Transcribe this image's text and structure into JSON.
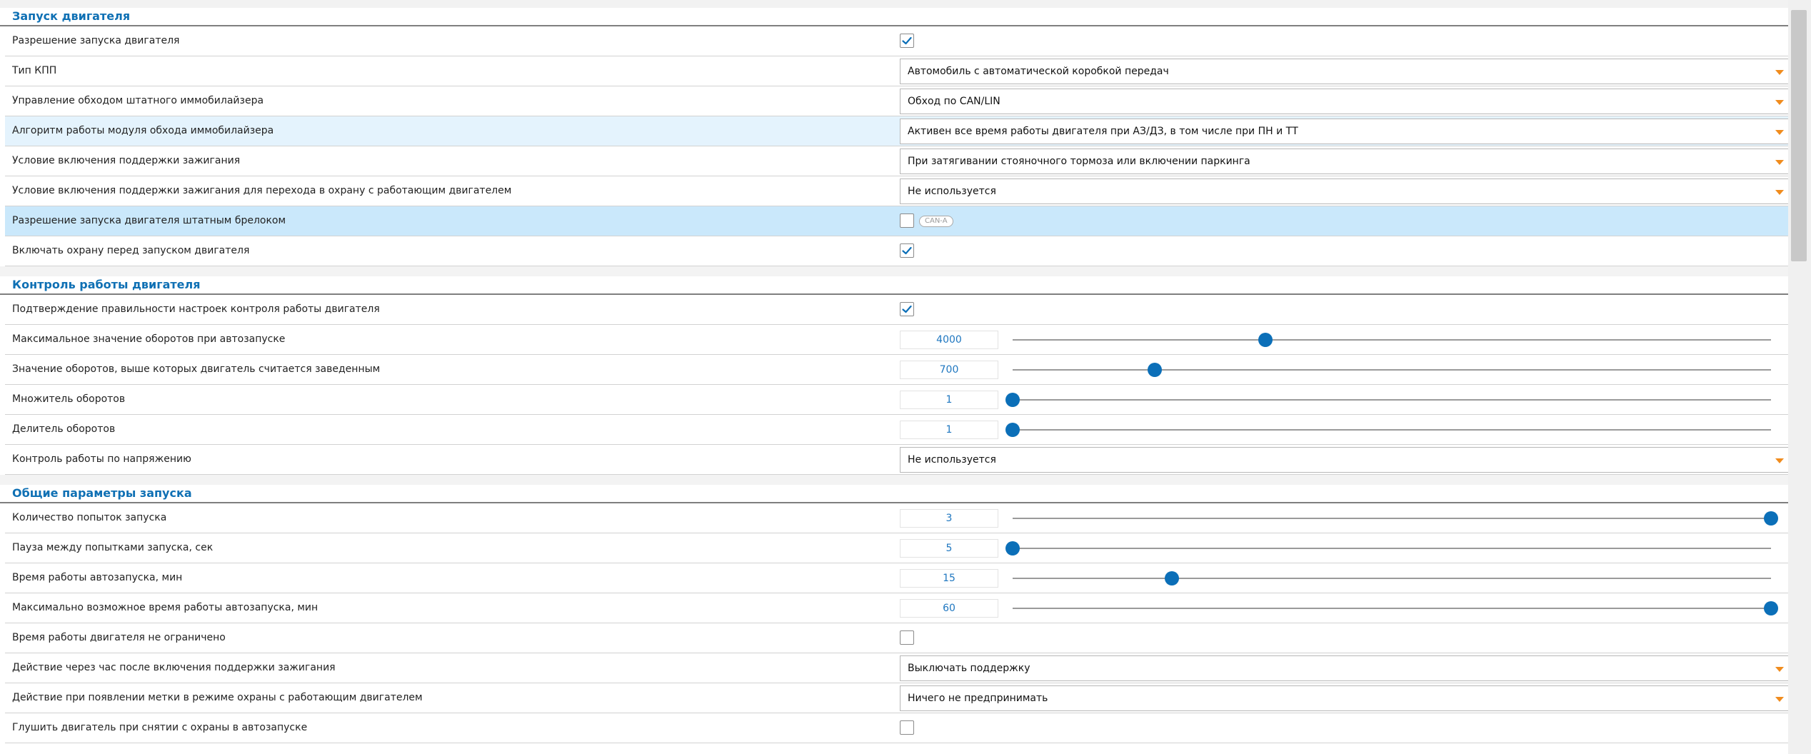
{
  "sections": [
    {
      "title": "Запуск двигателя",
      "rows": [
        {
          "label": "Разрешение запуска двигателя",
          "type": "checkbox",
          "checked": true
        },
        {
          "label": "Тип КПП",
          "type": "select",
          "value": "Автомобиль с автоматической коробкой передач"
        },
        {
          "label": "Управление обходом штатного иммобилайзера",
          "type": "select",
          "value": "Обход по CAN/LIN"
        },
        {
          "label": "Алгоритм работы модуля обхода иммобилайзера",
          "type": "select",
          "value": "Активен все время работы двигателя при АЗ/ДЗ, в том числе при ПН и ТТ",
          "highlight": "light"
        },
        {
          "label": "Условие включения поддержки зажигания",
          "type": "select",
          "value": "При затягивании стояночного тормоза или включении паркинга"
        },
        {
          "label": "Условие включения поддержки зажигания для перехода в охрану с работающим двигателем",
          "type": "select",
          "value": "Не используется"
        },
        {
          "label": "Разрешение запуска двигателя штатным брелоком",
          "type": "checkbox",
          "checked": false,
          "badge": "CAN-A",
          "highlight": "strong"
        },
        {
          "label": "Включать охрану перед запуском двигателя",
          "type": "checkbox",
          "checked": true
        }
      ]
    },
    {
      "title": "Контроль работы двигателя",
      "rows": [
        {
          "label": "Подтверждение правильности настроек контроля работы двигателя",
          "type": "checkbox",
          "checked": true
        },
        {
          "label": "Максимальное значение оборотов при автозапуске",
          "type": "slider",
          "value": "4000",
          "fraction": 0.333
        },
        {
          "label": "Значение оборотов, выше которых двигатель считается заведенным",
          "type": "slider",
          "value": "700",
          "fraction": 0.187
        },
        {
          "label": "Множитель оборотов",
          "type": "slider",
          "value": "1",
          "fraction": 0.0
        },
        {
          "label": "Делитель оборотов",
          "type": "slider",
          "value": "1",
          "fraction": 0.0
        },
        {
          "label": "Контроль работы по напряжению",
          "type": "select",
          "value": "Не используется"
        }
      ]
    },
    {
      "title": "Общие параметры запуска",
      "rows": [
        {
          "label": "Количество попыток запуска",
          "type": "slider",
          "value": "3",
          "fraction": 1.0
        },
        {
          "label": "Пауза между попытками запуска, сек",
          "type": "slider",
          "value": "5",
          "fraction": 0.0
        },
        {
          "label": "Время работы автозапуска, мин",
          "type": "slider",
          "value": "15",
          "fraction": 0.21
        },
        {
          "label": "Максимально возможное время работы автозапуска, мин",
          "type": "slider",
          "value": "60",
          "fraction": 1.0
        },
        {
          "label": "Время работы двигателя не ограничено",
          "type": "checkbox",
          "checked": false
        },
        {
          "label": "Действие через час после включения поддержки зажигания",
          "type": "select",
          "value": "Выключать поддержку"
        },
        {
          "label": "Действие при появлении метки в режиме охраны с работающим двигателем",
          "type": "select",
          "value": "Ничего не предпринимать"
        },
        {
          "label": "Глушить двигатель при снятии с охраны в автозапуске",
          "type": "checkbox",
          "checked": false
        }
      ]
    }
  ],
  "colors": {
    "section_title": "#0f70b4",
    "slider_thumb": "#0b6fb8",
    "select_arrow": "#f08c1e",
    "row_highlight_light": "#e4f3fd",
    "row_highlight_strong": "#cae8fb"
  }
}
